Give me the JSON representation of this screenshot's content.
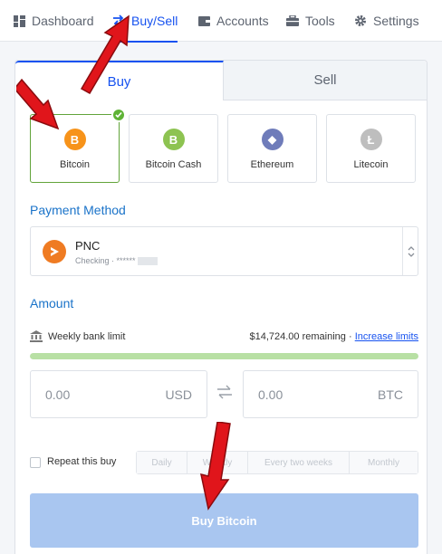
{
  "nav": {
    "items": [
      {
        "label": "Dashboard",
        "icon": "dashboard-icon"
      },
      {
        "label": "Buy/Sell",
        "icon": "swap-arrows-icon",
        "active": true
      },
      {
        "label": "Accounts",
        "icon": "wallet-icon"
      },
      {
        "label": "Tools",
        "icon": "briefcase-icon"
      },
      {
        "label": "Settings",
        "icon": "gear-icon"
      }
    ]
  },
  "tabs": {
    "buy": "Buy",
    "sell": "Sell"
  },
  "coins": [
    {
      "label": "Bitcoin",
      "symbol": "B",
      "color": "#f7931a",
      "selected": true
    },
    {
      "label": "Bitcoin Cash",
      "symbol": "B",
      "color": "#8dc351"
    },
    {
      "label": "Ethereum",
      "symbol": "◆",
      "color": "#6f7cba"
    },
    {
      "label": "Litecoin",
      "symbol": "Ł",
      "color": "#bebebe"
    }
  ],
  "payment": {
    "title": "Payment Method",
    "name": "PNC",
    "sub": "Checking · ******"
  },
  "amount": {
    "title": "Amount",
    "limit_label": "Weekly bank limit",
    "remaining": "$14,724.00 remaining",
    "separator": "·",
    "increase_link": "Increase limits",
    "usd_value": "0.00",
    "usd_currency": "USD",
    "btc_value": "0.00",
    "btc_currency": "BTC"
  },
  "repeat": {
    "label": "Repeat this buy",
    "options": [
      "Daily",
      "Weekly",
      "Every two weeks",
      "Monthly"
    ]
  },
  "buy_button": "Buy Bitcoin",
  "colors": {
    "accent": "#1652f0",
    "section_title": "#1a73c9",
    "selected_border": "#62a43a",
    "annotation_arrow": "#e0151b",
    "button_disabled": "#a9c6f0"
  }
}
